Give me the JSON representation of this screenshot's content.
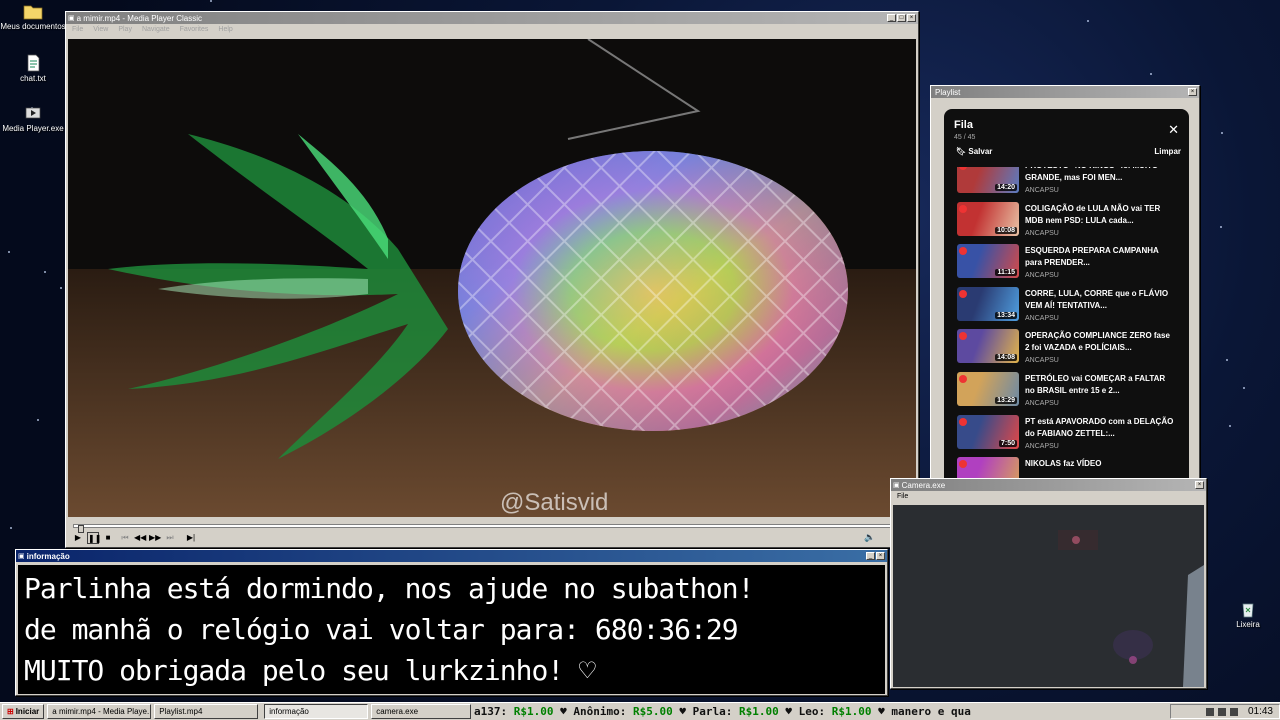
{
  "desktop": {
    "icons": [
      {
        "label": "Meus documentos",
        "icon": "folder-icon"
      },
      {
        "label": "chat.txt",
        "icon": "text-file-icon"
      },
      {
        "label": "Media Player.exe",
        "icon": "media-player-icon"
      },
      {
        "label": "Lixeira",
        "icon": "recycle-bin-icon"
      }
    ]
  },
  "media_player": {
    "title": "a mimir.mp4 - Media Player Classic",
    "menu": [
      "File",
      "View",
      "Play",
      "Navigate",
      "Favorites",
      "Help"
    ],
    "watermark": "@Satisvid",
    "progress": 0.005
  },
  "playlist_window": {
    "title": "Playlist",
    "header": "Fila",
    "count": "45 / 45",
    "save_label": "Salvar",
    "clear_label": "Limpar",
    "items": [
      {
        "title": "PROTESTO \"NO KINGS\" foi MUITO GRANDE, mas FOI MEN...",
        "duration": "14:20",
        "channel": "ANCAPSU"
      },
      {
        "title": "COLIGAÇÃO de LULA NÃO vai TER MDB nem PSD: LULA cada...",
        "duration": "10:08",
        "channel": "ANCAPSU"
      },
      {
        "title": "ESQUERDA PREPARA CAMPANHA para PRENDER...",
        "duration": "11:15",
        "channel": "ANCAPSU"
      },
      {
        "title": "CORRE, LULA, CORRE que o FLÁVIO VEM AÍ! TENTATIVA...",
        "duration": "13:34",
        "channel": "ANCAPSU"
      },
      {
        "title": "OPERAÇÃO COMPLIANCE ZERO fase 2 foi VAZADA e POLÍCIAIS...",
        "duration": "14:08",
        "channel": "ANCAPSU"
      },
      {
        "title": "PETRÓLEO vai COMEÇAR a FALTAR no BRASIL entre 15 e 2...",
        "duration": "13:29",
        "channel": "ANCAPSU"
      },
      {
        "title": "PT está APAVORADO com a DELAÇÃO do FABIANO ZETTEL:...",
        "duration": "7:50",
        "channel": "ANCAPSU"
      },
      {
        "title": "NIKOLAS faz VÍDEO",
        "duration": "",
        "channel": ""
      }
    ]
  },
  "camera_window": {
    "title": "Camera.exe",
    "menu": [
      "File"
    ]
  },
  "info_window": {
    "title": "informação",
    "lines": [
      "Parlinha está dormindo, nos ajude no subathon!",
      "de manhã o relógio vai voltar para:  680:36:29",
      "MUITO obrigada pelo seu lurkzinho! ♡"
    ]
  },
  "taskbar": {
    "start_label": "Iniciar",
    "buttons": [
      "a mimir.mp4 - Media Playe...",
      "Playlist.mp4",
      "informação",
      "camera.exe"
    ],
    "active_button": "informação",
    "ticker": [
      {
        "name": "a137:",
        "amount": "R$1.00"
      },
      {
        "name": "Anônimo:",
        "amount": "R$5.00"
      },
      {
        "name": "Parla:",
        "amount": "R$1.00"
      },
      {
        "name": "Leo:",
        "amount": "R$1.00"
      },
      {
        "name": "manero e qua",
        "amount": ""
      }
    ],
    "clock": "01:43"
  },
  "colors": {
    "desktop_bg": "#06102a",
    "active_title": "#0a246a",
    "ticker_amount": "#008000"
  }
}
